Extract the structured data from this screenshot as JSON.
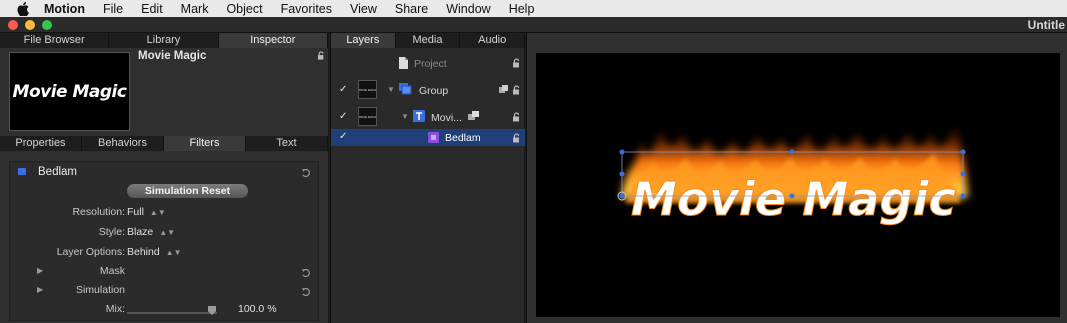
{
  "menubar": {
    "app": "Motion",
    "items": [
      "File",
      "Edit",
      "Mark",
      "Object",
      "Favorites",
      "View",
      "Share",
      "Window",
      "Help"
    ]
  },
  "window": {
    "title": "Untitle"
  },
  "inspector": {
    "tabs": [
      "File Browser",
      "Library",
      "Inspector"
    ],
    "active_tab": "Inspector",
    "preview_text": "Movie Magic",
    "object_name": "Movie Magic",
    "subtabs": [
      "Properties",
      "Behaviors",
      "Filters",
      "Text"
    ],
    "active_subtab": "Filters",
    "filter": {
      "name": "Bedlam",
      "sim_reset_label": "Simulation Reset",
      "params": [
        {
          "label": "Resolution:",
          "value": "Full"
        },
        {
          "label": "Style:",
          "value": "Blaze"
        },
        {
          "label": "Layer Options:",
          "value": "Behind"
        }
      ],
      "groups": [
        "Mask",
        "Simulation"
      ],
      "mix_label": "Mix:",
      "mix_value": "100.0",
      "mix_unit": "%"
    }
  },
  "layers": {
    "tabs": [
      "Layers",
      "Media",
      "Audio"
    ],
    "active_tab": "Layers",
    "items": [
      {
        "name": "Project",
        "checked": false
      },
      {
        "name": "Group",
        "checked": true
      },
      {
        "name": "Movi...",
        "checked": true
      },
      {
        "name": "Bedlam",
        "checked": true,
        "selected": true
      }
    ],
    "thumb_text": "MOVIE MAGIC"
  },
  "canvas": {
    "text": "Movie Magic"
  },
  "colors": {
    "accent": "#3a6ee8",
    "selected_row": "#1f3f78",
    "fire_outer": "#c02a08",
    "fire_inner": "#ffb020"
  }
}
